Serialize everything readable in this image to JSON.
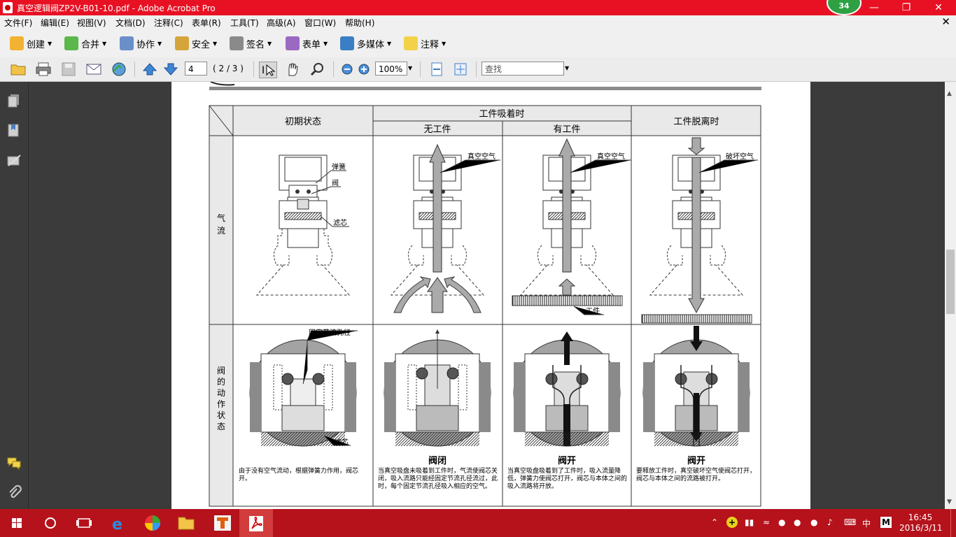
{
  "window": {
    "title": "真空逻辑阀ZP2V-B01-10.pdf - Adobe Acrobat Pro",
    "notification_count": "34"
  },
  "menu": {
    "items": [
      "文件(F)",
      "编辑(E)",
      "视图(V)",
      "文档(D)",
      "注释(C)",
      "表单(R)",
      "工具(T)",
      "高级(A)",
      "窗口(W)",
      "帮助(H)"
    ]
  },
  "toolbar1": {
    "items": [
      "创建",
      "合并",
      "协作",
      "安全",
      "签名",
      "表单",
      "多媒体",
      "注释"
    ]
  },
  "toolbar2": {
    "page_number": "4",
    "page_count": "( 2 / 3 )",
    "zoom": "100%",
    "search_placeholder": "查找"
  },
  "document": {
    "header_col1": "初期状态",
    "header_group": "工件吸着时",
    "header_sub1": "无工件",
    "header_sub2": "有工件",
    "header_col4": "工件脱离时",
    "row1_label": "气流",
    "row2_label": "阀的动作状态",
    "label_spring": "弹簧",
    "label_valve": "阀",
    "label_filter": "滤芯",
    "label_vacuum": "真空空气",
    "label_break": "破坏空气",
    "label_work": "工件",
    "label_orifice": "固定节流孔径",
    "state_closed": "阀闭",
    "state_open": "阀开",
    "desc1": "由于没有空气流动，根据弹簧力作用，阀芯开。",
    "desc2": "当真空吸盘未吸着到工件时，气流使阀芯关闭，吸入流路只能经固定节流孔径流过，此时，每个固定节流孔径吸入相应的空气。",
    "desc3": "当真空吸盘吸着到了工件时，吸入流量降低，弹簧力使阀芯打开，阀芯与本体之间的吸入流路将开放。",
    "desc4": "要释放工件时，真空破坏空气使阀芯打开，阀芯与本体之间的流路被打开。"
  },
  "taskbar": {
    "ime": "中",
    "ime_mode": "M",
    "time": "16:45",
    "date": "2016/3/11"
  },
  "colors": {
    "titlebar": "#e81123",
    "taskbar": "#b5121b",
    "panel": "#3b3b3b"
  }
}
